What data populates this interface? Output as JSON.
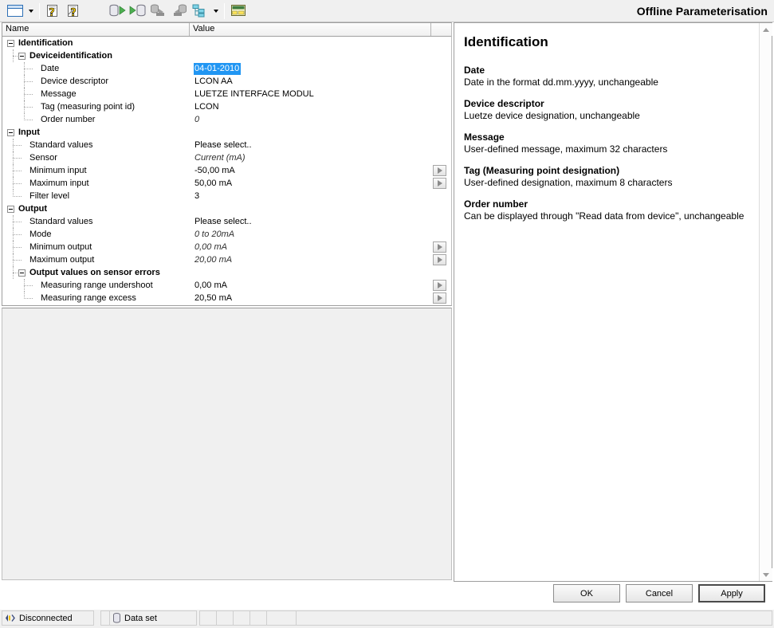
{
  "window": {
    "title": "Offline Parameterisation"
  },
  "toolbar": {
    "items": [
      {
        "name": "new-document-button",
        "icon": "window-icon"
      },
      {
        "name": "new-document-dropdown",
        "icon": "chevron-down-icon"
      },
      {
        "name": "device-help-button",
        "icon": "device-question-icon"
      },
      {
        "name": "dtm-help-button",
        "icon": "dtm-question-icon"
      },
      {
        "name": "read-from-device-button",
        "icon": "upload-device-icon"
      },
      {
        "name": "write-to-device-button",
        "icon": "download-device-icon"
      },
      {
        "name": "load-from-disk-button",
        "icon": "load-disk-icon"
      },
      {
        "name": "save-to-disk-button",
        "icon": "save-disk-icon"
      },
      {
        "name": "topology-button",
        "icon": "network-tree-icon"
      },
      {
        "name": "topology-dropdown",
        "icon": "chevron-down-icon"
      },
      {
        "name": "export-button",
        "icon": "spreadsheet-export-icon"
      }
    ]
  },
  "grid": {
    "columns": [
      "Name",
      "Value"
    ],
    "rows": [
      {
        "label": "Identification",
        "value": "",
        "level": 0,
        "type": "group",
        "expander": true,
        "italic": false,
        "selected": false,
        "button": false
      },
      {
        "label": "Deviceidentification",
        "value": "",
        "level": 1,
        "type": "group",
        "expander": true,
        "italic": false,
        "selected": false,
        "button": false
      },
      {
        "label": "Date",
        "value": "04-01-2010",
        "level": 2,
        "type": "leaf",
        "expander": false,
        "italic": false,
        "selected": true,
        "button": false
      },
      {
        "label": "Device descriptor",
        "value": "LCON AA",
        "level": 2,
        "type": "leaf",
        "expander": false,
        "italic": false,
        "selected": false,
        "button": false
      },
      {
        "label": "Message",
        "value": "LUETZE INTERFACE MODUL",
        "level": 2,
        "type": "leaf",
        "expander": false,
        "italic": false,
        "selected": false,
        "button": false
      },
      {
        "label": "Tag (measuring point id)",
        "value": "LCON",
        "level": 2,
        "type": "leaf",
        "expander": false,
        "italic": false,
        "selected": false,
        "button": false
      },
      {
        "label": "Order number",
        "value": "0",
        "level": 2,
        "type": "leaf",
        "expander": false,
        "italic": true,
        "selected": false,
        "button": false
      },
      {
        "label": "Input",
        "value": "",
        "level": 0,
        "type": "group",
        "expander": true,
        "italic": false,
        "selected": false,
        "button": false
      },
      {
        "label": "Standard values",
        "value": "Please select..",
        "level": 1,
        "type": "leaf",
        "expander": false,
        "italic": false,
        "selected": false,
        "button": false
      },
      {
        "label": "Sensor",
        "value": "Current (mA)",
        "level": 1,
        "type": "leaf",
        "expander": false,
        "italic": true,
        "selected": false,
        "button": false
      },
      {
        "label": "Minimum input",
        "value": "-50,00 mA",
        "level": 1,
        "type": "leaf",
        "expander": false,
        "italic": false,
        "selected": false,
        "button": true
      },
      {
        "label": "Maximum input",
        "value": "50,00 mA",
        "level": 1,
        "type": "leaf",
        "expander": false,
        "italic": false,
        "selected": false,
        "button": true
      },
      {
        "label": "Filter level",
        "value": "3",
        "level": 1,
        "type": "leaf",
        "expander": false,
        "italic": false,
        "selected": false,
        "button": false
      },
      {
        "label": "Output",
        "value": "",
        "level": 0,
        "type": "group",
        "expander": true,
        "italic": false,
        "selected": false,
        "button": false
      },
      {
        "label": "Standard values",
        "value": "Please select..",
        "level": 1,
        "type": "leaf",
        "expander": false,
        "italic": false,
        "selected": false,
        "button": false
      },
      {
        "label": "Mode",
        "value": "0 to 20mA",
        "level": 1,
        "type": "leaf",
        "expander": false,
        "italic": true,
        "selected": false,
        "button": false
      },
      {
        "label": "Minimum output",
        "value": "0,00 mA",
        "level": 1,
        "type": "leaf",
        "expander": false,
        "italic": true,
        "selected": false,
        "button": true
      },
      {
        "label": "Maximum output",
        "value": "20,00 mA",
        "level": 1,
        "type": "leaf",
        "expander": false,
        "italic": true,
        "selected": false,
        "button": true
      },
      {
        "label": "Output values on sensor errors",
        "value": "",
        "level": 1,
        "type": "group",
        "expander": true,
        "italic": false,
        "selected": false,
        "button": false
      },
      {
        "label": "Measuring range undershoot",
        "value": "0,00 mA",
        "level": 2,
        "type": "leaf",
        "expander": false,
        "italic": false,
        "selected": false,
        "button": true
      },
      {
        "label": "Measuring range excess",
        "value": "20,50 mA",
        "level": 2,
        "type": "leaf",
        "expander": false,
        "italic": false,
        "selected": false,
        "button": true
      }
    ]
  },
  "help": {
    "title": "Identification",
    "entries": [
      {
        "term": "Date",
        "desc": "Date in the format dd.mm.yyyy, unchangeable"
      },
      {
        "term": "Device descriptor",
        "desc": "Luetze device designation, unchangeable"
      },
      {
        "term": "Message",
        "desc": "User-defined message, maximum 32 characters"
      },
      {
        "term": "Tag (Measuring point designation)",
        "desc": "User-defined designation, maximum 8 characters"
      },
      {
        "term": "Order number",
        "desc": "Can be displayed through \"Read data from device\", unchangeable"
      }
    ]
  },
  "buttons": {
    "ok": "OK",
    "cancel": "Cancel",
    "apply": "Apply"
  },
  "statusbar": {
    "connection": "Disconnected",
    "dataset": "Data set"
  },
  "colors": {
    "selection": "#2196f3",
    "toolbar_bg": "#f0f0f0",
    "pane_bg": "#ffffff"
  }
}
